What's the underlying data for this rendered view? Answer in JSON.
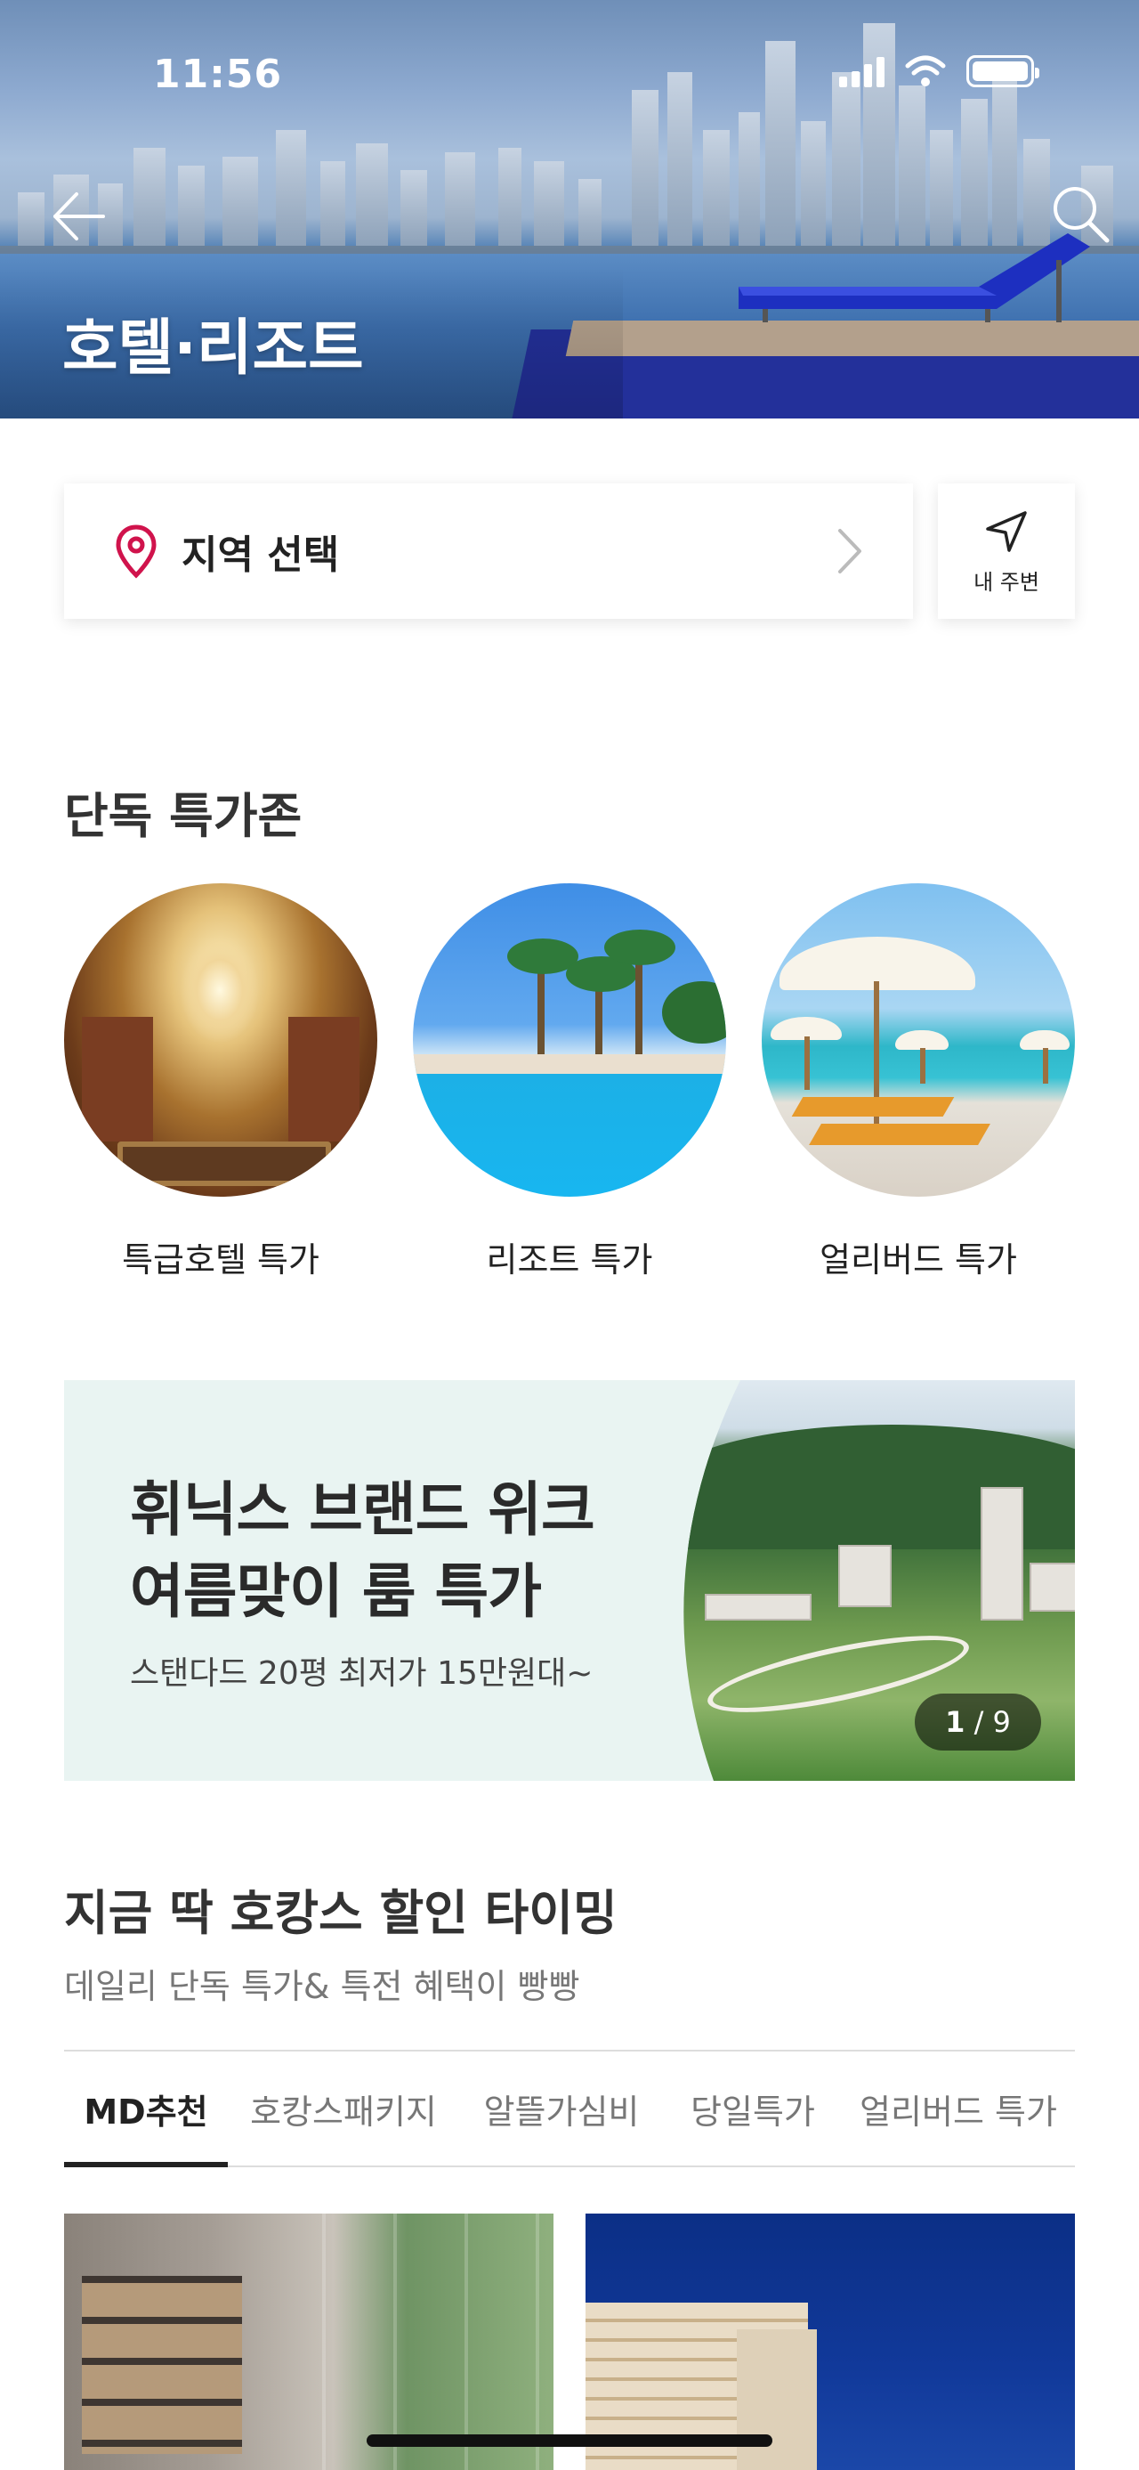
{
  "status_bar": {
    "time": "11:56"
  },
  "header": {
    "title": "호텔·리조트"
  },
  "icons": {
    "back": "arrow-left-icon",
    "search": "search-icon",
    "location": "map-pin-icon",
    "chevron": "chevron-right-icon",
    "nearby": "navigation-arrow-icon"
  },
  "colors": {
    "accent": "#d0134c",
    "text": "#222222",
    "muted": "#777777",
    "banner_bg": "#e9f4f2"
  },
  "region": {
    "label": "지역 선택",
    "nearby_label": "내 주변"
  },
  "exclusive": {
    "title": "단독 특가존",
    "items": [
      {
        "label": "특급호텔 특가"
      },
      {
        "label": "리조트 특가"
      },
      {
        "label": "얼리버드 특가"
      }
    ]
  },
  "banner": {
    "title_line1": "휘닉스 브랜드 위크",
    "title_line2": "여름맞이 룸 특가",
    "subtitle": "스탠다드 20평 최저가 15만원대~",
    "page_current": "1",
    "page_total": "9"
  },
  "timing": {
    "title": "지금 딱 호캉스 할인 타이밍",
    "subtitle": "데일리 단독 특가& 특전 혜택이 빵빵",
    "tabs": [
      {
        "label": "MD추천",
        "active": true
      },
      {
        "label": "호캉스패키지",
        "active": false
      },
      {
        "label": "알뜰가심비",
        "active": false
      },
      {
        "label": "당일특가",
        "active": false
      },
      {
        "label": "얼리버드 특가",
        "active": false
      }
    ]
  }
}
